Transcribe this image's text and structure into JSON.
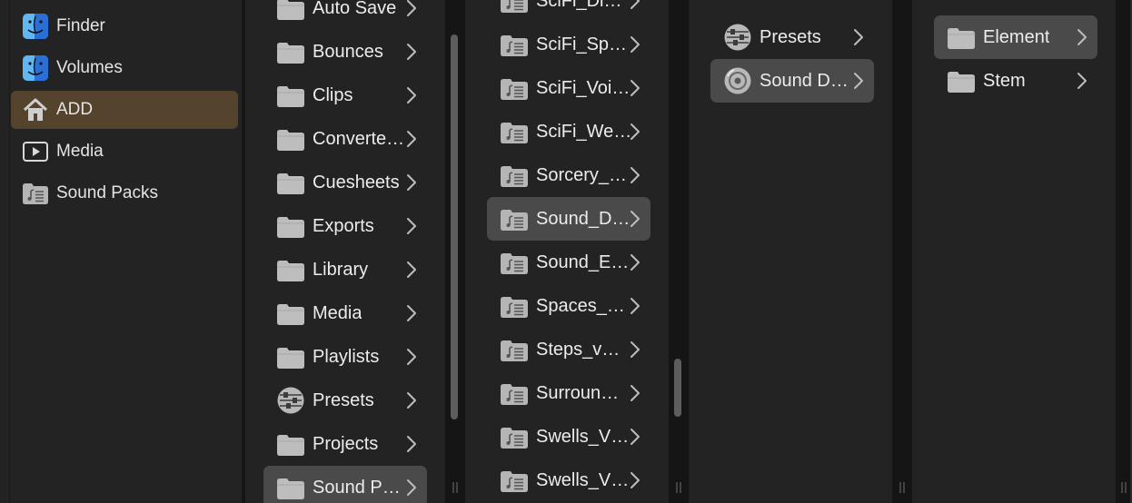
{
  "sidebar": {
    "items": [
      {
        "label": "Finder",
        "icon": "finder-icon"
      },
      {
        "label": "Volumes",
        "icon": "finder-icon"
      },
      {
        "label": "ADD",
        "icon": "home-icon",
        "selected": true
      },
      {
        "label": "Media",
        "icon": "play-box-icon"
      },
      {
        "label": "Sound Packs",
        "icon": "sound-folder-icon"
      }
    ]
  },
  "column1": {
    "items": [
      {
        "label": "Auto Save",
        "icon": "folder-icon"
      },
      {
        "label": "Bounces",
        "icon": "folder-icon"
      },
      {
        "label": "Clips",
        "icon": "folder-icon"
      },
      {
        "label": "Converte…",
        "icon": "folder-icon"
      },
      {
        "label": "Cuesheets",
        "icon": "folder-icon"
      },
      {
        "label": "Exports",
        "icon": "folder-icon"
      },
      {
        "label": "Library",
        "icon": "folder-icon"
      },
      {
        "label": "Media",
        "icon": "folder-icon"
      },
      {
        "label": "Playlists",
        "icon": "folder-icon"
      },
      {
        "label": "Presets",
        "icon": "sliders-icon"
      },
      {
        "label": "Projects",
        "icon": "folder-icon"
      },
      {
        "label": "Sound P…",
        "icon": "folder-icon",
        "selected": true
      }
    ]
  },
  "column2": {
    "items": [
      {
        "label": "SciFi_Di…",
        "icon": "sound-folder-icon"
      },
      {
        "label": "SciFi_Sp…",
        "icon": "sound-folder-icon"
      },
      {
        "label": "SciFi_Voi…",
        "icon": "sound-folder-icon"
      },
      {
        "label": "SciFi_We…",
        "icon": "sound-folder-icon"
      },
      {
        "label": "Sorcery_…",
        "icon": "sound-folder-icon"
      },
      {
        "label": "Sound_D…",
        "icon": "sound-folder-icon",
        "selected": true
      },
      {
        "label": "Sound_E…",
        "icon": "sound-folder-icon"
      },
      {
        "label": "Spaces_…",
        "icon": "sound-folder-icon"
      },
      {
        "label": "Steps_v…",
        "icon": "sound-folder-icon"
      },
      {
        "label": "Surroun…",
        "icon": "sound-folder-icon"
      },
      {
        "label": "Swells_V…",
        "icon": "sound-folder-icon"
      },
      {
        "label": "Swells_V…",
        "icon": "sound-folder-icon"
      }
    ]
  },
  "column3": {
    "items": [
      {
        "label": "Presets",
        "icon": "sliders-icon"
      },
      {
        "label": "Sound D…",
        "icon": "disc-icon",
        "selected": true
      }
    ]
  },
  "column4": {
    "items": [
      {
        "label": "Element",
        "icon": "folder-icon",
        "selected": true
      },
      {
        "label": "Stem",
        "icon": "folder-icon"
      }
    ]
  }
}
